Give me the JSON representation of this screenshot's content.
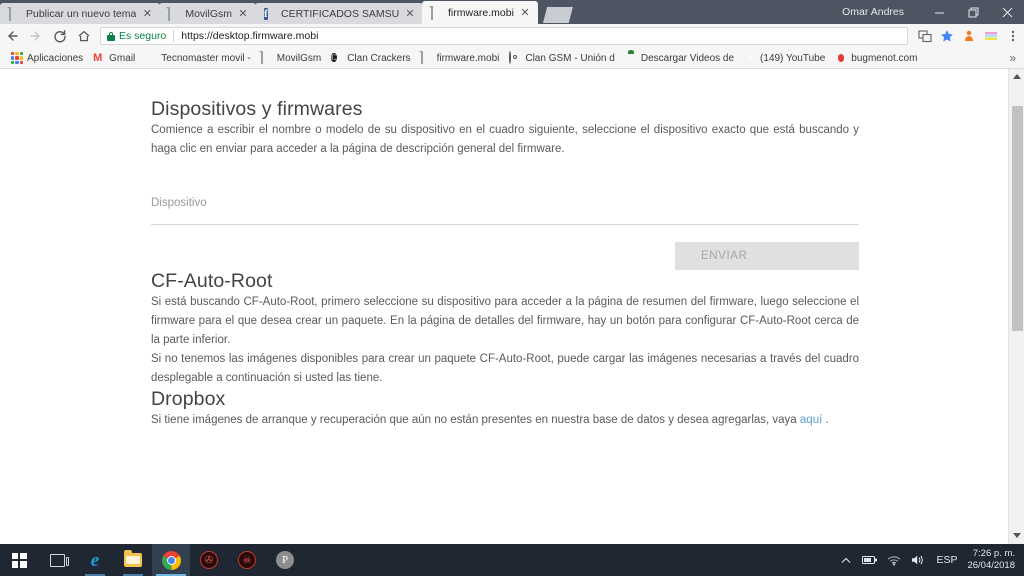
{
  "browser": {
    "window_user": "Omar Andres",
    "window_buttons": {
      "minimize": "minimize-icon",
      "restore": "restore-icon",
      "close": "close-icon"
    },
    "tabs": [
      {
        "title": "Publicar un nuevo tema",
        "favicon": "page-icon",
        "active": false
      },
      {
        "title": "MovilGsm",
        "favicon": "page-icon",
        "active": false
      },
      {
        "title": "CERTIFICADOS SAMSUNG",
        "favicon": "facebook-icon",
        "active": false
      },
      {
        "title": "firmware.mobi",
        "favicon": "page-icon",
        "active": true
      }
    ],
    "new_tab_label": "",
    "toolbar": {
      "back": "back-arrow-icon",
      "forward": "forward-arrow-icon",
      "reload": "reload-icon",
      "home": "home-icon",
      "security_label": "Es seguro",
      "url": "https://desktop.firmware.mobi",
      "right_icons": [
        "translate-icon",
        "bookmark-star-icon",
        "extension-orange-icon",
        "extension-colorful-icon",
        "chrome-menu-icon"
      ]
    },
    "bookmarks": [
      {
        "label": "Aplicaciones",
        "icon": "apps-grid-icon"
      },
      {
        "label": "Gmail",
        "icon": "gmail-icon"
      },
      {
        "label": "Tecnomaster movil -",
        "icon": "pin-icon"
      },
      {
        "label": "MovilGsm",
        "icon": "page-icon"
      },
      {
        "label": "Clan Crackers",
        "icon": "clan-icon"
      },
      {
        "label": "firmware.mobi",
        "icon": "page-icon"
      },
      {
        "label": "Clan GSM - Unión d",
        "icon": "spiral-icon"
      },
      {
        "label": "Descargar Videos de",
        "icon": "tomato-icon"
      },
      {
        "label": "(149) YouTube",
        "icon": "youtube-icon"
      },
      {
        "label": "bugmenot.com",
        "icon": "bug-icon"
      }
    ],
    "bookmarks_overflow": "»"
  },
  "page": {
    "title": "Dispositivos y firmwares",
    "intro": "Comience a escribir el nombre o modelo de su dispositivo en el cuadro siguiente, seleccione el dispositivo exacto que está buscando y haga clic en enviar para acceder a la página de descripción general del firmware.",
    "device_field": {
      "placeholder": "Dispositivo",
      "value": ""
    },
    "submit_label": "ENVIAR",
    "cf_auto_root": {
      "heading": "CF-Auto-Root",
      "paragraph1": "Si está buscando CF-Auto-Root, primero seleccione su dispositivo para acceder a la página de resumen del firmware, luego seleccione el firmware para el que desea crear un paquete. En la página de detalles del firmware, hay un botón para configurar CF-Auto-Root cerca de la parte inferior.",
      "paragraph2": "Si no tenemos las imágenes disponibles para crear un paquete CF-Auto-Root, puede cargar las imágenes necesarias a través del cuadro desplegable a continuación si usted las tiene."
    },
    "dropbox": {
      "heading": "Dropbox",
      "paragraph_before": "Si tiene imágenes de arranque y recuperación que aún no están presentes en nuestra base de datos y desea agregarlas, vaya ",
      "link_text": "aquí",
      "paragraph_after": " ."
    }
  },
  "taskbar": {
    "items": [
      {
        "name": "start-button",
        "icon": "windows-logo-icon"
      },
      {
        "name": "task-view-button",
        "icon": "task-view-icon"
      },
      {
        "name": "edge-button",
        "icon": "edge-icon"
      },
      {
        "name": "file-explorer-button",
        "icon": "folder-icon"
      },
      {
        "name": "chrome-button",
        "icon": "chrome-icon"
      },
      {
        "name": "app-red-one-button",
        "icon": "red-circle-icon"
      },
      {
        "name": "app-red-two-button",
        "icon": "red-skull-icon"
      },
      {
        "name": "app-p-button",
        "icon": "letter-p-icon"
      }
    ],
    "tray": {
      "show_hidden": "chevron-up-icon",
      "battery": "battery-icon",
      "network": "wifi-icon",
      "volume": "speaker-icon",
      "language": "ESP",
      "time": "7:26 p. m.",
      "date": "26/04/2018"
    }
  },
  "colors": {
    "chrome_frame": "#4d5562",
    "taskbar": "#1f2733",
    "link": "#5a9fd4",
    "secure_green": "#0b8043",
    "disabled_button": "#e0e0e0"
  }
}
